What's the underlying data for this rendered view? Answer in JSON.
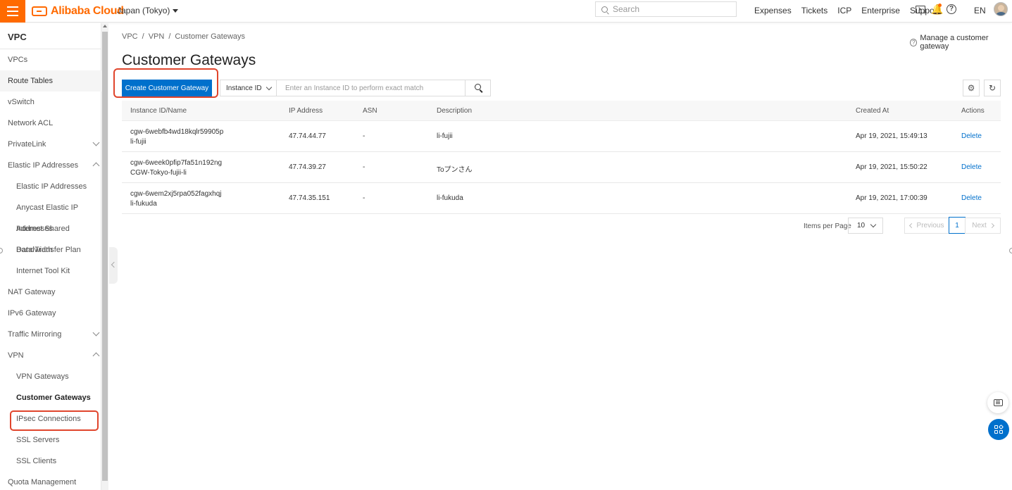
{
  "topbar": {
    "brand": "Alibaba Cloud",
    "region": "Japan (Tokyo)",
    "search_placeholder": "Search",
    "links": [
      "Expenses",
      "Tickets",
      "ICP",
      "Enterprise",
      "Support"
    ],
    "language": "EN",
    "brand_color": "#ff6a00"
  },
  "sidebar": {
    "title": "VPC",
    "items": [
      {
        "label": "VPCs"
      },
      {
        "label": "Route Tables"
      },
      {
        "label": "vSwitch"
      },
      {
        "label": "Network ACL"
      },
      {
        "label": "PrivateLink"
      },
      {
        "label": "Elastic IP Addresses"
      },
      {
        "label": "Elastic IP Addresses"
      },
      {
        "label": "Anycast Elastic IP Addresses"
      },
      {
        "label": "Internet Shared Bandwidth"
      },
      {
        "label": "Data Transfer Plan"
      },
      {
        "label": "Internet Tool Kit"
      },
      {
        "label": "NAT Gateway"
      },
      {
        "label": "IPv6 Gateway"
      },
      {
        "label": "Traffic Mirroring"
      },
      {
        "label": "VPN"
      },
      {
        "label": "VPN Gateways"
      },
      {
        "label": "Customer Gateways"
      },
      {
        "label": "IPsec Connections"
      },
      {
        "label": "SSL Servers"
      },
      {
        "label": "SSL Clients"
      },
      {
        "label": "Quota Management"
      }
    ]
  },
  "breadcrumb": [
    "VPC",
    "/",
    "VPN",
    "/",
    "Customer Gateways"
  ],
  "manage_link": "Manage a customer gateway",
  "page_title": "Customer Gateways",
  "toolbar": {
    "create_label": "Create Customer Gateway",
    "filter_field": "Instance ID",
    "filter_placeholder": "Enter an Instance ID to perform exact match",
    "accent_color": "#0070cc"
  },
  "table": {
    "columns": [
      "Instance ID/Name",
      "IP Address",
      "ASN",
      "Description",
      "Created At",
      "Actions"
    ],
    "rows": [
      {
        "id": "cgw-6webfb4wd18kqlr59905p",
        "name": "li-fujii",
        "ip": "47.74.44.77",
        "asn": "-",
        "description": "li-fujii",
        "created": "Apr 19, 2021, 15:49:13",
        "action": "Delete"
      },
      {
        "id": "cgw-6week0pfip7fa51n192ng",
        "name": "CGW-Tokyo-fujii-li",
        "ip": "47.74.39.27",
        "asn": "-",
        "description": "Toプンさん",
        "created": "Apr 19, 2021, 15:50:22",
        "action": "Delete"
      },
      {
        "id": "cgw-6wem2xj5rpa052fagxhqj",
        "name": "li-fukuda",
        "ip": "47.74.35.151",
        "asn": "-",
        "description": "li-fukuda",
        "created": "Apr 19, 2021, 17:00:39",
        "action": "Delete"
      }
    ]
  },
  "pagination": {
    "items_per_page_label": "Items per Page",
    "items_per_page": "10",
    "previous": "Previous",
    "current_page": "1",
    "next": "Next"
  }
}
